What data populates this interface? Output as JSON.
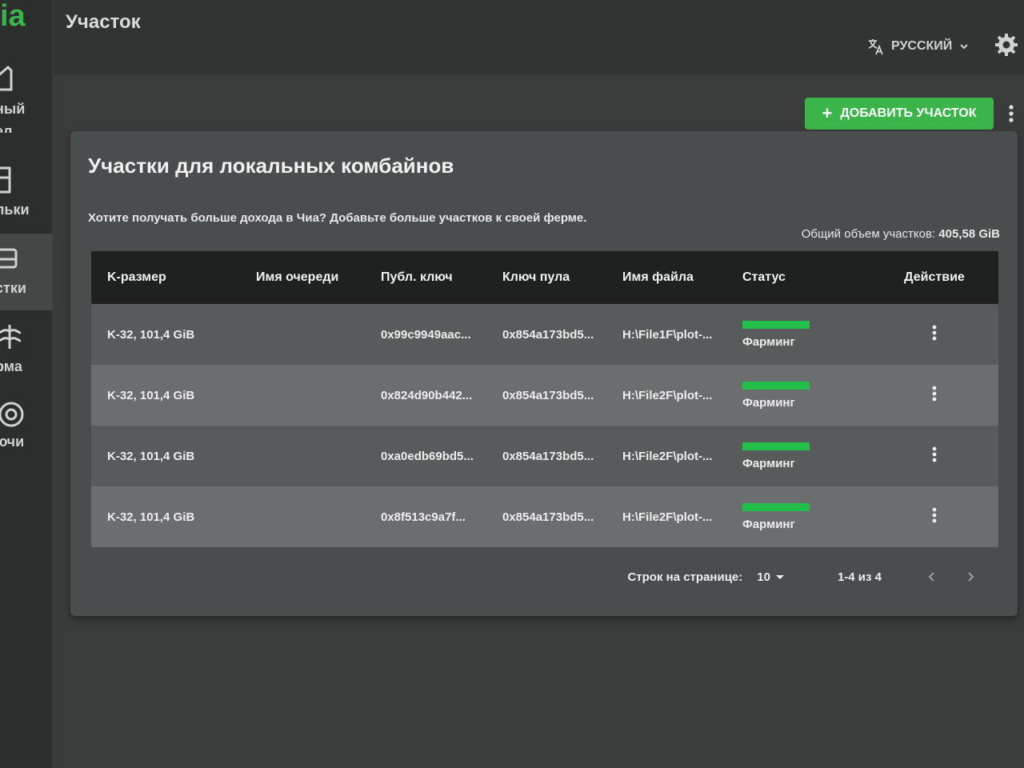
{
  "app": {
    "logo_text": "ia"
  },
  "sidebar": {
    "items": [
      {
        "label": "ный\nел",
        "icon": "home-icon"
      },
      {
        "label": "льки",
        "icon": "wallet-icon"
      },
      {
        "label": "стки",
        "icon": "plots-icon",
        "active": true
      },
      {
        "label": "рма",
        "icon": "farm-icon"
      },
      {
        "label": "ючи",
        "icon": "keys-icon"
      }
    ]
  },
  "header": {
    "title": "Участок",
    "language": "РУССКИЙ"
  },
  "toolbar": {
    "add_label": "ДОБАВИТЬ УЧАСТОК"
  },
  "card": {
    "title": "Участки для локальных комбайнов",
    "description": "Хотите получать больше дохода в Чиа? Добавьте больше участков к своей ферме.",
    "total_label": "Общий объем участков:",
    "total_value": "405,58 GiB"
  },
  "table": {
    "columns": [
      "K-размер",
      "Имя очереди",
      "Публ. ключ",
      "Ключ пула",
      "Имя файла",
      "Статус",
      "Действие"
    ],
    "rows": [
      {
        "size": "K-32, 101,4 GiB",
        "queue": "",
        "pubkey": "0x99c9949aac...",
        "poolkey": "0x854a173bd5...",
        "filename": "H:\\File1F\\plot-...",
        "status": "Фарминг"
      },
      {
        "size": "K-32, 101,4 GiB",
        "queue": "",
        "pubkey": "0x824d90b442...",
        "poolkey": "0x854a173bd5...",
        "filename": "H:\\File2F\\plot-...",
        "status": "Фарминг"
      },
      {
        "size": "K-32, 101,4 GiB",
        "queue": "",
        "pubkey": "0xa0edb69bd5...",
        "poolkey": "0x854a173bd5...",
        "filename": "H:\\File2F\\plot-...",
        "status": "Фарминг"
      },
      {
        "size": "K-32, 101,4 GiB",
        "queue": "",
        "pubkey": "0x8f513c9a7f...",
        "poolkey": "0x854a173bd5...",
        "filename": "H:\\File2F\\plot-...",
        "status": "Фарминг"
      }
    ]
  },
  "pagination": {
    "rows_per_page_label": "Строк на странице:",
    "rows_per_page": "10",
    "range": "1-4 из 4"
  },
  "colors": {
    "accent": "#3bb54a",
    "status_farming": "#22c04a"
  }
}
